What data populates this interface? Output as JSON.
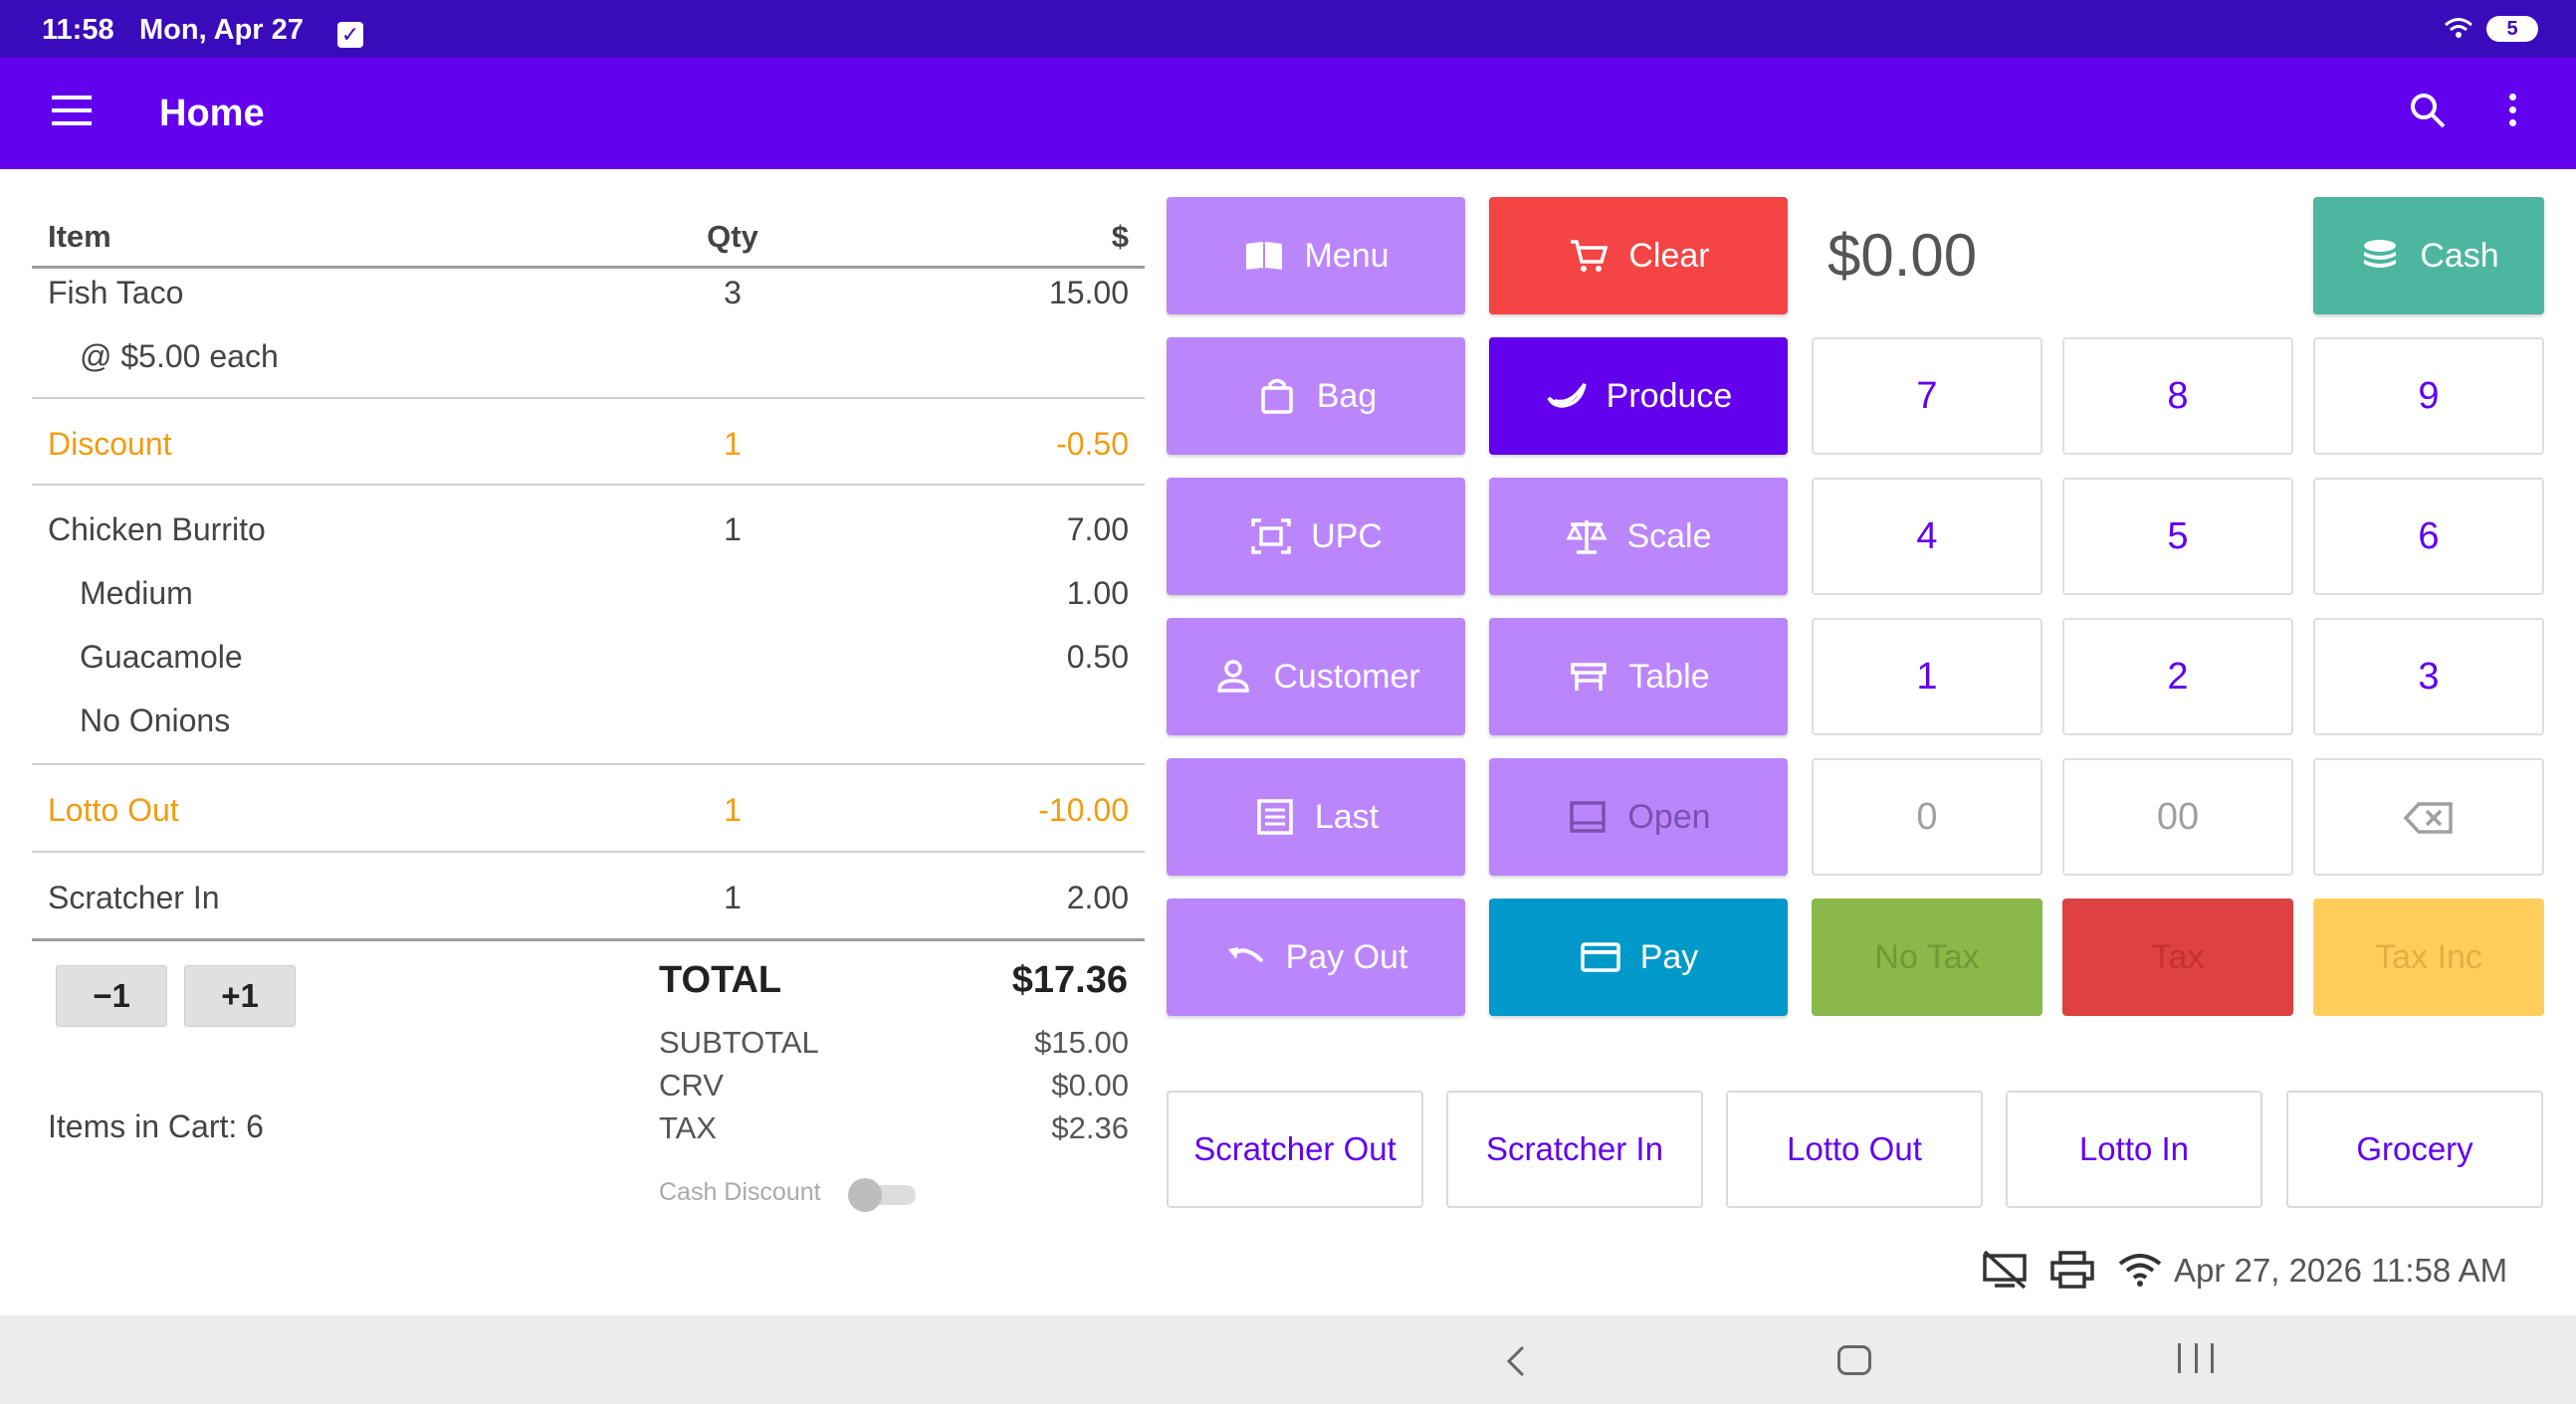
{
  "status_bar": {
    "time": "11:58",
    "date": "Mon, Apr 27",
    "battery": "5"
  },
  "app_bar": {
    "title": "Home"
  },
  "cart": {
    "headers": {
      "item": "Item",
      "qty": "Qty",
      "amount": "$"
    },
    "lines": [
      {
        "name": "Fish Taco",
        "qty": "3",
        "amount": "15.00",
        "note": "@ $5.00 each"
      },
      {
        "name": "Discount",
        "qty": "1",
        "amount": "-0.50"
      },
      {
        "name": "Chicken Burrito",
        "qty": "1",
        "amount": "7.00",
        "modifiers": [
          {
            "name": "Medium",
            "amount": "1.00"
          },
          {
            "name": "Guacamole",
            "amount": "0.50"
          },
          {
            "name": "No Onions",
            "amount": ""
          }
        ]
      },
      {
        "name": "Lotto Out",
        "qty": "1",
        "amount": "-10.00"
      },
      {
        "name": "Scratcher In",
        "qty": "1",
        "amount": "2.00"
      }
    ],
    "minus_label": "−1",
    "plus_label": "+1",
    "items_in_cart": "Items in Cart:  6"
  },
  "totals": {
    "total_label": "TOTAL",
    "total_value": "$17.36",
    "subtotal_label": "SUBTOTAL",
    "subtotal_value": "$15.00",
    "crv_label": "CRV",
    "crv_value": "$0.00",
    "tax_label": "TAX",
    "tax_value": "$2.36",
    "cash_discount_label": "Cash Discount",
    "cash_discount_on": false
  },
  "actions": {
    "menu": "Menu",
    "clear": "Clear",
    "cash": "Cash",
    "bag": "Bag",
    "produce": "Produce",
    "upc": "UPC",
    "scale": "Scale",
    "customer": "Customer",
    "table": "Table",
    "last": "Last",
    "open": "Open",
    "pay_out": "Pay Out",
    "pay": "Pay",
    "no_tax": "No Tax",
    "tax": "Tax",
    "tax_inc": "Tax Inc"
  },
  "amount_display": "$0.00",
  "keypad": [
    "7",
    "8",
    "9",
    "4",
    "5",
    "6",
    "1",
    "2",
    "3",
    "0",
    "00"
  ],
  "quick_keys": [
    "Scratcher Out",
    "Scratcher In",
    "Lotto Out",
    "Lotto In",
    "Grocery"
  ],
  "footer": {
    "datetime": "Apr 27, 2026 11:58 AM"
  },
  "colors": {
    "primary": "#6200ee",
    "status_bar": "#3a0bbb",
    "button_light": "#bb86fc",
    "clear_red": "#f44444",
    "cash_teal": "#4db6a0",
    "pay_blue": "#0099c9",
    "orange_line": "#f29c0f"
  }
}
